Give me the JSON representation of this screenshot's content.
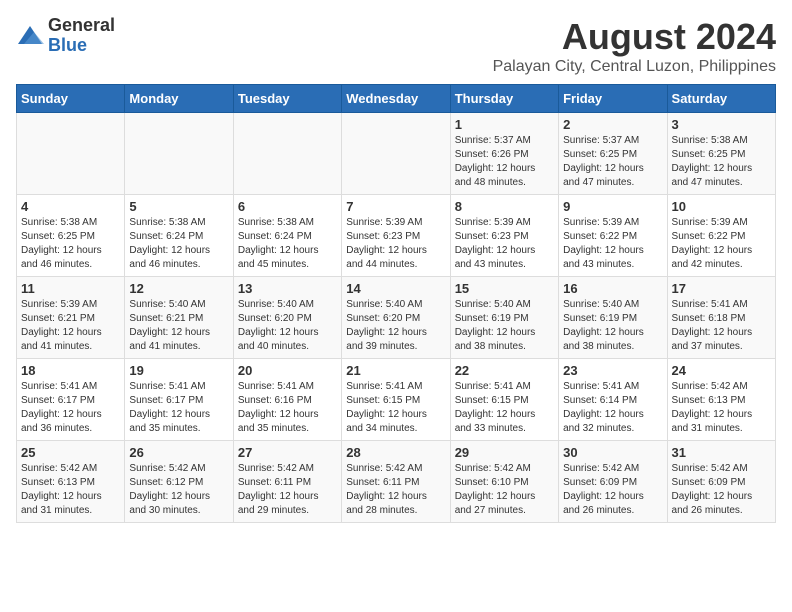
{
  "logo": {
    "general": "General",
    "blue": "Blue"
  },
  "title": "August 2024",
  "subtitle": "Palayan City, Central Luzon, Philippines",
  "days_of_week": [
    "Sunday",
    "Monday",
    "Tuesday",
    "Wednesday",
    "Thursday",
    "Friday",
    "Saturday"
  ],
  "weeks": [
    [
      {
        "day": "",
        "info": ""
      },
      {
        "day": "",
        "info": ""
      },
      {
        "day": "",
        "info": ""
      },
      {
        "day": "",
        "info": ""
      },
      {
        "day": "1",
        "info": "Sunrise: 5:37 AM\nSunset: 6:26 PM\nDaylight: 12 hours\nand 48 minutes."
      },
      {
        "day": "2",
        "info": "Sunrise: 5:37 AM\nSunset: 6:25 PM\nDaylight: 12 hours\nand 47 minutes."
      },
      {
        "day": "3",
        "info": "Sunrise: 5:38 AM\nSunset: 6:25 PM\nDaylight: 12 hours\nand 47 minutes."
      }
    ],
    [
      {
        "day": "4",
        "info": "Sunrise: 5:38 AM\nSunset: 6:25 PM\nDaylight: 12 hours\nand 46 minutes."
      },
      {
        "day": "5",
        "info": "Sunrise: 5:38 AM\nSunset: 6:24 PM\nDaylight: 12 hours\nand 46 minutes."
      },
      {
        "day": "6",
        "info": "Sunrise: 5:38 AM\nSunset: 6:24 PM\nDaylight: 12 hours\nand 45 minutes."
      },
      {
        "day": "7",
        "info": "Sunrise: 5:39 AM\nSunset: 6:23 PM\nDaylight: 12 hours\nand 44 minutes."
      },
      {
        "day": "8",
        "info": "Sunrise: 5:39 AM\nSunset: 6:23 PM\nDaylight: 12 hours\nand 43 minutes."
      },
      {
        "day": "9",
        "info": "Sunrise: 5:39 AM\nSunset: 6:22 PM\nDaylight: 12 hours\nand 43 minutes."
      },
      {
        "day": "10",
        "info": "Sunrise: 5:39 AM\nSunset: 6:22 PM\nDaylight: 12 hours\nand 42 minutes."
      }
    ],
    [
      {
        "day": "11",
        "info": "Sunrise: 5:39 AM\nSunset: 6:21 PM\nDaylight: 12 hours\nand 41 minutes."
      },
      {
        "day": "12",
        "info": "Sunrise: 5:40 AM\nSunset: 6:21 PM\nDaylight: 12 hours\nand 41 minutes."
      },
      {
        "day": "13",
        "info": "Sunrise: 5:40 AM\nSunset: 6:20 PM\nDaylight: 12 hours\nand 40 minutes."
      },
      {
        "day": "14",
        "info": "Sunrise: 5:40 AM\nSunset: 6:20 PM\nDaylight: 12 hours\nand 39 minutes."
      },
      {
        "day": "15",
        "info": "Sunrise: 5:40 AM\nSunset: 6:19 PM\nDaylight: 12 hours\nand 38 minutes."
      },
      {
        "day": "16",
        "info": "Sunrise: 5:40 AM\nSunset: 6:19 PM\nDaylight: 12 hours\nand 38 minutes."
      },
      {
        "day": "17",
        "info": "Sunrise: 5:41 AM\nSunset: 6:18 PM\nDaylight: 12 hours\nand 37 minutes."
      }
    ],
    [
      {
        "day": "18",
        "info": "Sunrise: 5:41 AM\nSunset: 6:17 PM\nDaylight: 12 hours\nand 36 minutes."
      },
      {
        "day": "19",
        "info": "Sunrise: 5:41 AM\nSunset: 6:17 PM\nDaylight: 12 hours\nand 35 minutes."
      },
      {
        "day": "20",
        "info": "Sunrise: 5:41 AM\nSunset: 6:16 PM\nDaylight: 12 hours\nand 35 minutes."
      },
      {
        "day": "21",
        "info": "Sunrise: 5:41 AM\nSunset: 6:15 PM\nDaylight: 12 hours\nand 34 minutes."
      },
      {
        "day": "22",
        "info": "Sunrise: 5:41 AM\nSunset: 6:15 PM\nDaylight: 12 hours\nand 33 minutes."
      },
      {
        "day": "23",
        "info": "Sunrise: 5:41 AM\nSunset: 6:14 PM\nDaylight: 12 hours\nand 32 minutes."
      },
      {
        "day": "24",
        "info": "Sunrise: 5:42 AM\nSunset: 6:13 PM\nDaylight: 12 hours\nand 31 minutes."
      }
    ],
    [
      {
        "day": "25",
        "info": "Sunrise: 5:42 AM\nSunset: 6:13 PM\nDaylight: 12 hours\nand 31 minutes."
      },
      {
        "day": "26",
        "info": "Sunrise: 5:42 AM\nSunset: 6:12 PM\nDaylight: 12 hours\nand 30 minutes."
      },
      {
        "day": "27",
        "info": "Sunrise: 5:42 AM\nSunset: 6:11 PM\nDaylight: 12 hours\nand 29 minutes."
      },
      {
        "day": "28",
        "info": "Sunrise: 5:42 AM\nSunset: 6:11 PM\nDaylight: 12 hours\nand 28 minutes."
      },
      {
        "day": "29",
        "info": "Sunrise: 5:42 AM\nSunset: 6:10 PM\nDaylight: 12 hours\nand 27 minutes."
      },
      {
        "day": "30",
        "info": "Sunrise: 5:42 AM\nSunset: 6:09 PM\nDaylight: 12 hours\nand 26 minutes."
      },
      {
        "day": "31",
        "info": "Sunrise: 5:42 AM\nSunset: 6:09 PM\nDaylight: 12 hours\nand 26 minutes."
      }
    ]
  ]
}
